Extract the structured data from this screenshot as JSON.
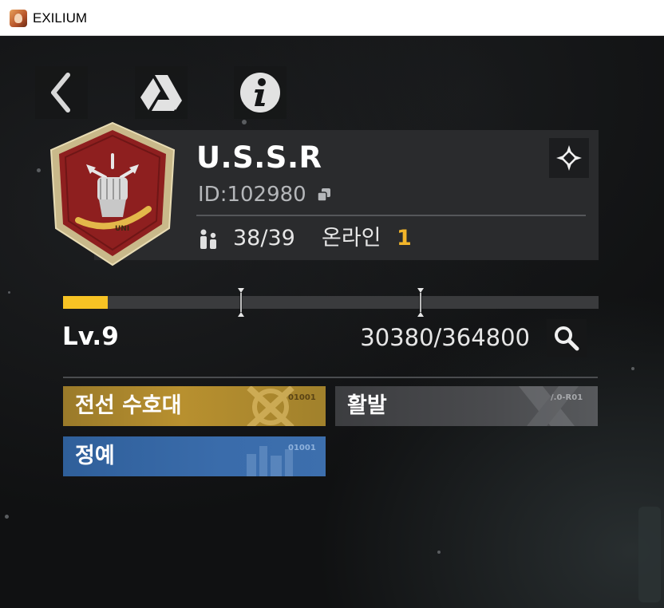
{
  "window": {
    "title": "EXILIUM",
    "app_icon": "game-portrait-icon"
  },
  "toolbar": {
    "back_icon": "chevron-left-icon",
    "drive_icon": "drive-triangle-icon",
    "info_icon": "info-circle-icon"
  },
  "guild": {
    "name": "U.S.S.R",
    "id_text": "ID:102980",
    "members": "38/39",
    "online_label": "온라인",
    "online_count": "1",
    "badge_text": "UNI",
    "colors": {
      "accent": "#f2b52a",
      "badge_bg": "#8e1f1f",
      "badge_border": "#c9b98a"
    }
  },
  "progress": {
    "level": "Lv.9",
    "xp_text": "30380/364800",
    "fill_fraction": 0.0833,
    "marker_fractions": [
      0.333,
      0.667
    ],
    "colors": {
      "fill": "#f7c324",
      "track": "#3a3b3d"
    }
  },
  "tags": [
    {
      "label": "전선 수호대",
      "code": "01001",
      "color": "#b8902f"
    },
    {
      "label": "활발",
      "code": "/.0-R01",
      "color": "#4a4b4e"
    },
    {
      "label": "정예",
      "code": "01001",
      "color": "#3a6cab"
    }
  ]
}
